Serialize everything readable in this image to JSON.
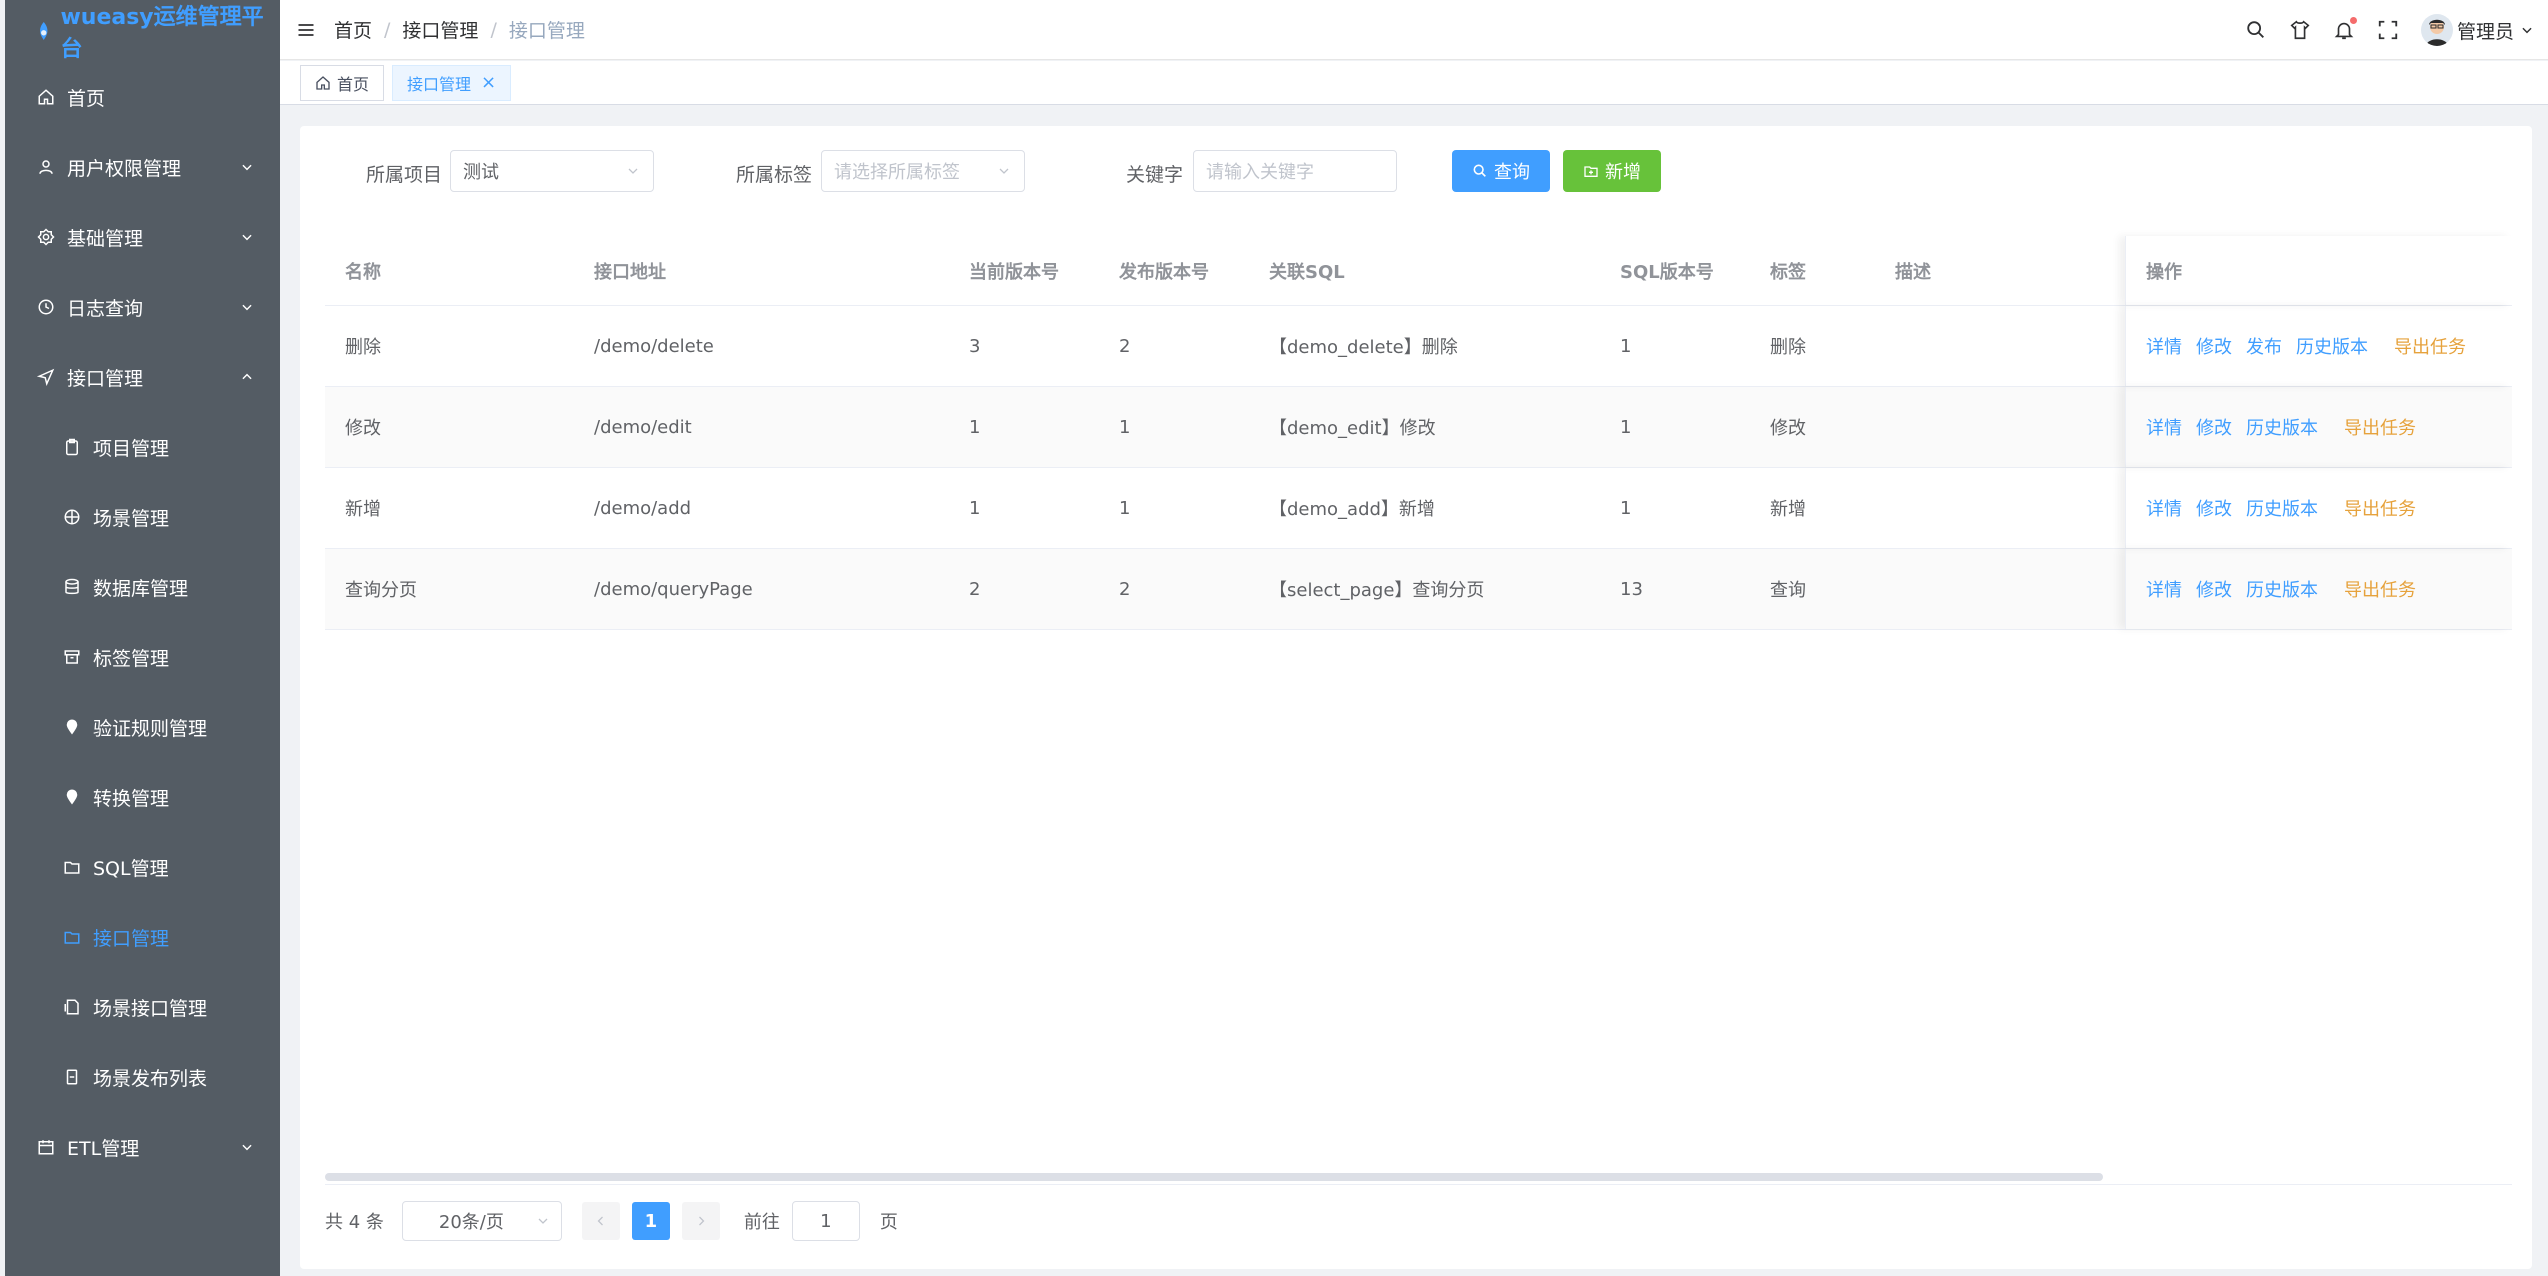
{
  "app": {
    "title": "wueasy运维管理平台"
  },
  "sidebar": {
    "items": [
      {
        "label": "首页",
        "icon": "home-icon"
      },
      {
        "label": "用户权限管理",
        "icon": "user-icon"
      },
      {
        "label": "基础管理",
        "icon": "gear-icon"
      },
      {
        "label": "日志查询",
        "icon": "clock-icon"
      },
      {
        "label": "接口管理",
        "icon": "send-icon"
      }
    ],
    "sub_items": [
      {
        "label": "项目管理",
        "icon": "clipboard-icon"
      },
      {
        "label": "场景管理",
        "icon": "globe-icon"
      },
      {
        "label": "数据库管理",
        "icon": "database-icon"
      },
      {
        "label": "标签管理",
        "icon": "box-icon"
      },
      {
        "label": "验证规则管理",
        "icon": "pin-icon"
      },
      {
        "label": "转换管理",
        "icon": "pin-icon"
      },
      {
        "label": "SQL管理",
        "icon": "folder-icon"
      },
      {
        "label": "接口管理",
        "icon": "folder-icon"
      },
      {
        "label": "场景接口管理",
        "icon": "document-icon"
      },
      {
        "label": "场景发布列表",
        "icon": "file-icon"
      }
    ],
    "etl": {
      "label": "ETL管理",
      "icon": "calendar-icon"
    }
  },
  "header": {
    "breadcrumb": [
      "首页",
      "接口管理",
      "接口管理"
    ],
    "user_name": "管理员"
  },
  "tags": {
    "home": "首页",
    "current": "接口管理"
  },
  "filters": {
    "project_label": "所属项目",
    "project_value": "测试",
    "tag_label": "所属标签",
    "tag_placeholder": "请选择所属标签",
    "keyword_label": "关键字",
    "keyword_placeholder": "请输入关键字",
    "search_button": "查询",
    "add_button": "新增"
  },
  "table": {
    "headers": [
      "名称",
      "接口地址",
      "当前版本号",
      "发布版本号",
      "关联SQL",
      "SQL版本号",
      "标签",
      "描述",
      "操作"
    ],
    "rows": [
      {
        "name": "删除",
        "path": "/demo/delete",
        "current_version": "3",
        "publish_version": "2",
        "sql": "【demo_delete】删除",
        "sql_version": "1",
        "tag": "删除",
        "desc": "",
        "ops": [
          "详情",
          "修改",
          "发布",
          "历史版本"
        ],
        "export": "导出任务"
      },
      {
        "name": "修改",
        "path": "/demo/edit",
        "current_version": "1",
        "publish_version": "1",
        "sql": "【demo_edit】修改",
        "sql_version": "1",
        "tag": "修改",
        "desc": "",
        "ops": [
          "详情",
          "修改",
          "历史版本"
        ],
        "export": "导出任务"
      },
      {
        "name": "新增",
        "path": "/demo/add",
        "current_version": "1",
        "publish_version": "1",
        "sql": "【demo_add】新增",
        "sql_version": "1",
        "tag": "新增",
        "desc": "",
        "ops": [
          "详情",
          "修改",
          "历史版本"
        ],
        "export": "导出任务"
      },
      {
        "name": "查询分页",
        "path": "/demo/queryPage",
        "current_version": "2",
        "publish_version": "2",
        "sql": "【select_page】查询分页",
        "sql_version": "13",
        "tag": "查询",
        "desc": "",
        "ops": [
          "详情",
          "修改",
          "历史版本"
        ],
        "export": "导出任务"
      }
    ]
  },
  "pagination": {
    "total_text": "共 4 条",
    "page_size": "20条/页",
    "current_page": "1",
    "goto_label": "前往",
    "goto_value": "1",
    "page_suffix": "页"
  },
  "colors": {
    "accent": "#409eff",
    "success": "#67c23a",
    "warning": "#e6a23c",
    "sidebar": "#545c64"
  }
}
